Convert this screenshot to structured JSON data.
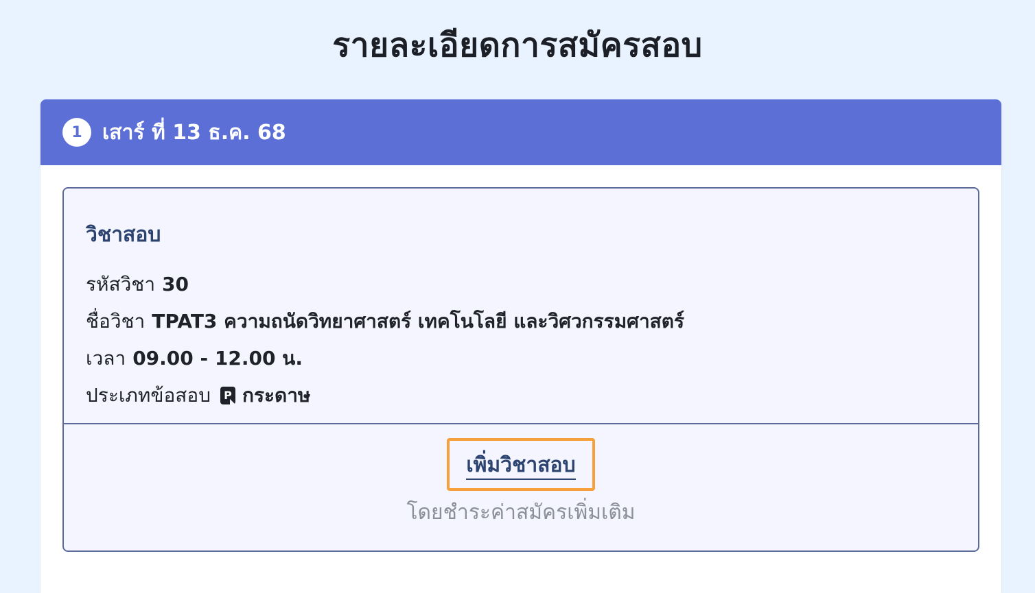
{
  "page": {
    "title": "รายละเอียดการสมัครสอบ"
  },
  "session": {
    "step_number": "1",
    "date_label": "เสาร์ ที่ 13 ธ.ค. 68"
  },
  "subject": {
    "heading": "วิชาสอบ",
    "code_label": "รหัสวิชา",
    "code_value": "30",
    "name_label": "ชื่อวิชา",
    "name_value": "TPAT3 ความถนัดวิทยาศาสตร์ เทคโนโลยี และวิศวกรรมศาสตร์",
    "time_label": "เวลา",
    "time_value": "09.00 - 12.00 น.",
    "type_label": "ประเภทข้อสอบ",
    "type_icon": "paper-exam-icon",
    "type_icon_glyph": "P",
    "type_value": "กระดาษ"
  },
  "actions": {
    "add_subject_label": "เพิ่มวิชาสอบ",
    "add_subject_note": "โดยชำระค่าสมัครเพิ่มเติม"
  },
  "colors": {
    "header_bg": "#5b6fd6",
    "page_bg": "#e9f3ff",
    "highlight": "#f5a03a"
  }
}
